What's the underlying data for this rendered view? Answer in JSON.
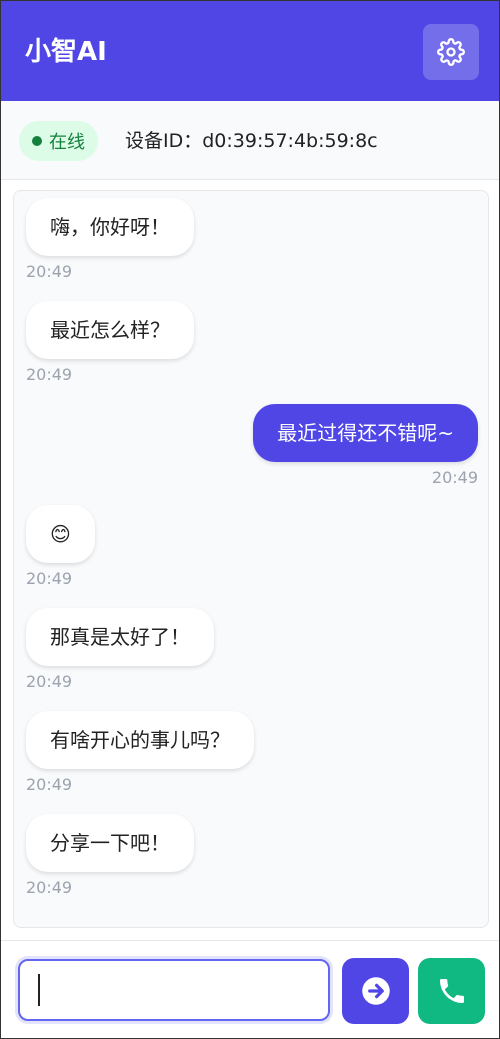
{
  "header": {
    "title": "小智AI",
    "settings_icon": "gear-icon"
  },
  "status": {
    "online_label": "在线",
    "device_id": "设备ID：d0:39:57:4b:59:8c"
  },
  "messages": [
    {
      "sender": "ai",
      "text": "嗨，你好呀！",
      "time": "20:49"
    },
    {
      "sender": "ai",
      "text": "最近怎么样？",
      "time": "20:49"
    },
    {
      "sender": "user",
      "text": "最近过得还不错呢~",
      "time": "20:49"
    },
    {
      "sender": "ai",
      "text": "😊",
      "time": "20:49"
    },
    {
      "sender": "ai",
      "text": "那真是太好了！",
      "time": "20:49"
    },
    {
      "sender": "ai",
      "text": "有啥开心的事儿吗？",
      "time": "20:49"
    },
    {
      "sender": "ai",
      "text": "分享一下吧！",
      "time": "20:49"
    }
  ],
  "input": {
    "value": "",
    "send_icon": "arrow-right-circle-icon",
    "call_icon": "phone-icon"
  },
  "colors": {
    "primary": "#4f46e5",
    "success": "#10b981",
    "online_bg": "#dcfce7",
    "online_text": "#15803d"
  }
}
